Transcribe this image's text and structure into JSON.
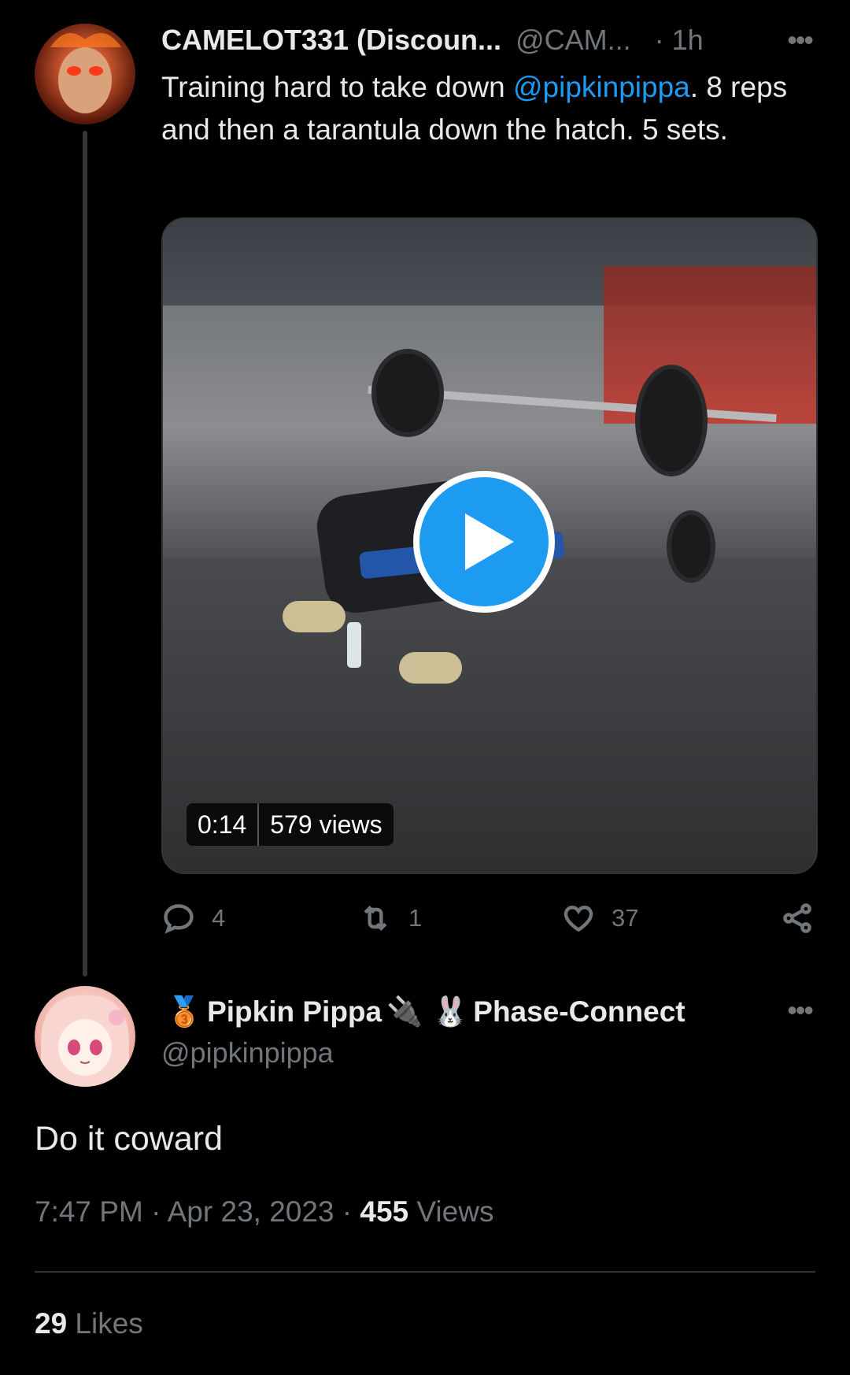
{
  "tweet": {
    "display_name": "CAMELOT331 (Discoun...",
    "handle": "@CAM...",
    "time": "· 1h",
    "more_label": "•••",
    "text_before": "Training hard to take down ",
    "mention": "@pipkinpippa",
    "text_after": ". 8 reps and then a tarantula down the hatch. 5 sets.",
    "video": {
      "duration": "0:14",
      "views": "579 views"
    },
    "actions": {
      "replies": "4",
      "retweets": "1",
      "likes": "37"
    }
  },
  "reply": {
    "badge_emoji": "🥉",
    "display_name": "Pipkin Pippa",
    "plug_emoji": "🔌",
    "bunny_emoji": "🐰",
    "affiliation": "Phase-Connect",
    "handle": "@pipkinpippa",
    "more_label": "•••",
    "text": "Do it coward",
    "timestamp": "7:47 PM · Apr 23, 2023 · ",
    "views_count": "455",
    "views_label": " Views",
    "likes_count": "29",
    "likes_label": " Likes"
  },
  "colors": {
    "accent": "#1d9bf0",
    "muted": "#71767b",
    "text": "#e7e9ea",
    "background": "#000000"
  }
}
